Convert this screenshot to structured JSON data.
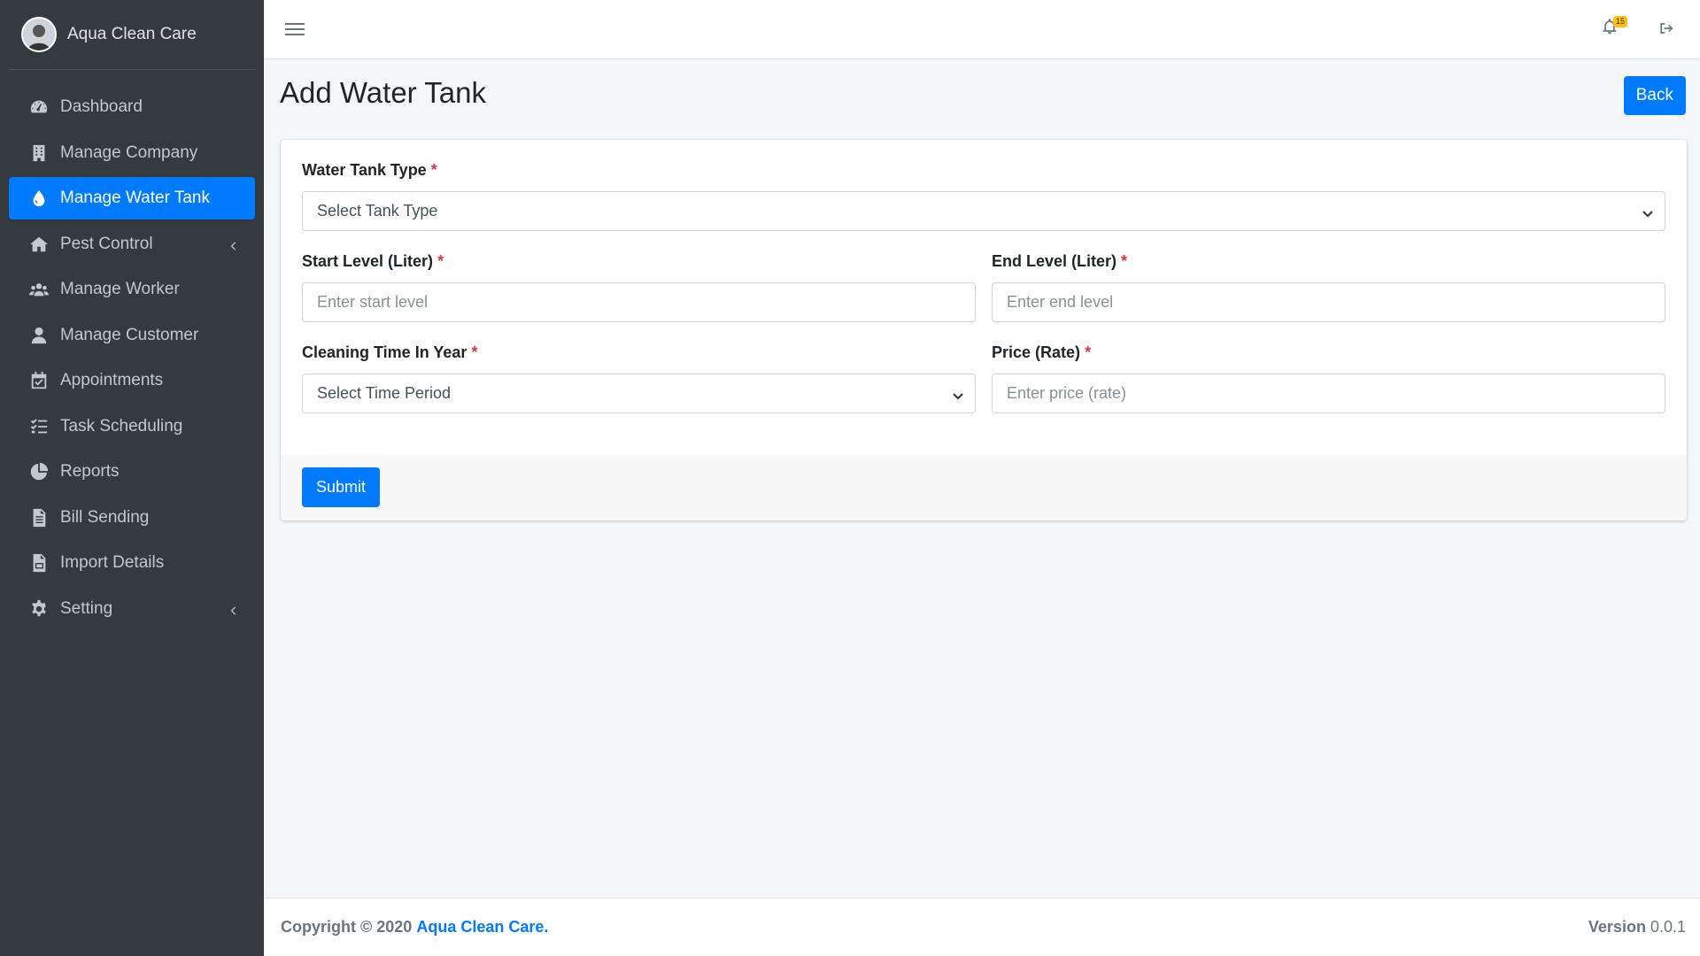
{
  "brand": {
    "name": "Aqua Clean Care"
  },
  "sidebar": {
    "items": [
      {
        "label": "Dashboard",
        "icon": "dashboard-icon",
        "active": false,
        "caret": false
      },
      {
        "label": "Manage Company",
        "icon": "building-icon",
        "active": false,
        "caret": false
      },
      {
        "label": "Manage Water Tank",
        "icon": "water-drop-icon",
        "active": true,
        "caret": false
      },
      {
        "label": "Pest Control",
        "icon": "home-icon",
        "active": false,
        "caret": true
      },
      {
        "label": "Manage Worker",
        "icon": "users-icon",
        "active": false,
        "caret": false
      },
      {
        "label": "Manage Customer",
        "icon": "user-icon",
        "active": false,
        "caret": false
      },
      {
        "label": "Appointments",
        "icon": "calendar-check-icon",
        "active": false,
        "caret": false
      },
      {
        "label": "Task Scheduling",
        "icon": "tasks-icon",
        "active": false,
        "caret": false
      },
      {
        "label": "Reports",
        "icon": "pie-chart-icon",
        "active": false,
        "caret": false
      },
      {
        "label": "Bill Sending",
        "icon": "file-text-icon",
        "active": false,
        "caret": false
      },
      {
        "label": "Import Details",
        "icon": "file-csv-icon",
        "active": false,
        "caret": false
      },
      {
        "label": "Setting",
        "icon": "gear-icon",
        "active": false,
        "caret": true
      }
    ]
  },
  "topbar": {
    "notification_count": "15"
  },
  "page": {
    "title": "Add Water Tank",
    "back_label": "Back"
  },
  "form": {
    "tank_type": {
      "label": "Water Tank Type",
      "required": "*",
      "value": "Select Tank Type"
    },
    "start_level": {
      "label": "Start Level (Liter)",
      "required": "*",
      "placeholder": "Enter start level"
    },
    "end_level": {
      "label": "End Level (Liter)",
      "required": "*",
      "placeholder": "Enter end level"
    },
    "cleaning_time": {
      "label": "Cleaning Time In Year",
      "required": "*",
      "value": "Select Time Period"
    },
    "price": {
      "label": "Price (Rate)",
      "required": "*",
      "placeholder": "Enter price (rate)"
    },
    "submit_label": "Submit"
  },
  "footer": {
    "copyright_prefix": "Copyright © 2020",
    "brand_link": "Aqua Clean Care.",
    "version_label": "Version",
    "version_value": "0.0.1"
  },
  "colors": {
    "primary": "#007bff",
    "sidebar": "#343a40",
    "required": "#dc3545",
    "badge": "#ffc107"
  }
}
